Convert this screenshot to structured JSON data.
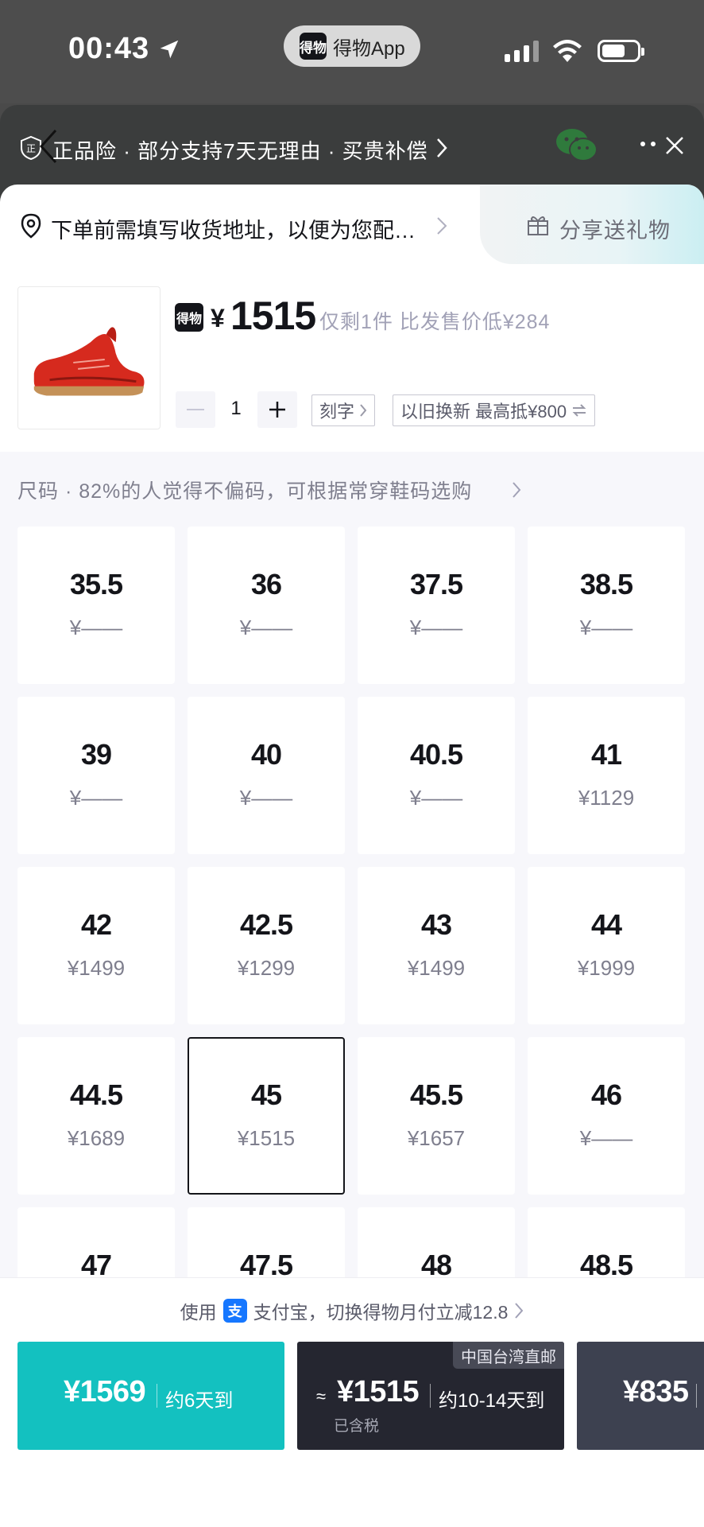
{
  "status_bar": {
    "time": "00:43",
    "app_name": "得物App",
    "app_logo": "得物",
    "icons": [
      "location-arrow-icon",
      "signal-icon",
      "wifi-icon",
      "battery-icon"
    ]
  },
  "top_banner": {
    "guarantee": "正品险 · 部分支持7天无理由 · 买贵补偿",
    "icons": [
      "back-icon",
      "shield-icon",
      "wechat-icon",
      "more-icon",
      "close-icon"
    ]
  },
  "address_bar": {
    "text": "下单前需填写收货地址，以便为您配…",
    "share": "分享送礼物"
  },
  "product": {
    "logo": "得物",
    "currency": "¥",
    "price": "1515",
    "note": "仅剩1件 比发售价低¥284",
    "quantity": "1",
    "engrave": "刻字",
    "trade_in": "以旧换新 最高抵¥800"
  },
  "size_hint": "尺码 · 82%的人觉得不偏码，可根据常穿鞋码选购",
  "sizes": [
    {
      "size": "35.5",
      "price": "¥——"
    },
    {
      "size": "36",
      "price": "¥——"
    },
    {
      "size": "37.5",
      "price": "¥——"
    },
    {
      "size": "38.5",
      "price": "¥——"
    },
    {
      "size": "39",
      "price": "¥——"
    },
    {
      "size": "40",
      "price": "¥——"
    },
    {
      "size": "40.5",
      "price": "¥——"
    },
    {
      "size": "41",
      "price": "¥1129"
    },
    {
      "size": "42",
      "price": "¥1499"
    },
    {
      "size": "42.5",
      "price": "¥1299"
    },
    {
      "size": "43",
      "price": "¥1499"
    },
    {
      "size": "44",
      "price": "¥1999"
    },
    {
      "size": "44.5",
      "price": "¥1689"
    },
    {
      "size": "45",
      "price": "¥1515",
      "selected": true
    },
    {
      "size": "45.5",
      "price": "¥1657"
    },
    {
      "size": "46",
      "price": "¥——"
    },
    {
      "size": "47",
      "price": ""
    },
    {
      "size": "47.5",
      "price": ""
    },
    {
      "size": "48",
      "price": ""
    },
    {
      "size": "48.5",
      "price": ""
    }
  ],
  "bottom": {
    "promo_prefix": "使用",
    "alipay_glyph": "支",
    "promo_text": "支付宝，切换得物月付立减12.8",
    "buy_options": [
      {
        "price": "¥1569",
        "eta": "约6天到"
      },
      {
        "approx": "≈",
        "price": "¥1515",
        "eta": "约10-14天到",
        "tax": "已含税",
        "tag": "中国台湾直邮"
      },
      {
        "price": "¥835"
      }
    ]
  },
  "colors": {
    "teal": "#13c1c0",
    "dark": "#252630",
    "accent_text": "#14151a",
    "muted_text": "#7f7f8e",
    "alipay_blue": "#1677ff"
  }
}
